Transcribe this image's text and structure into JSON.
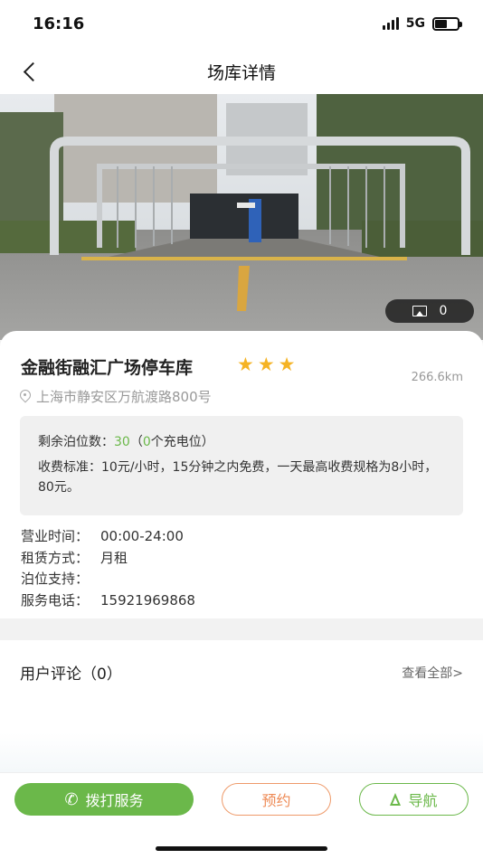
{
  "status": {
    "time": "16:16",
    "network": "5G"
  },
  "nav": {
    "title": "场库详情"
  },
  "hero": {
    "photo_count": "0"
  },
  "lot": {
    "name": "金融街融汇广场停车库",
    "stars": 3,
    "distance": "266.6km",
    "address": "上海市静安区万航渡路800号"
  },
  "spaces": {
    "remaining_label": "剩余泊位数：",
    "remaining_value": "30",
    "charging_open": "（",
    "charging_value": "0",
    "charging_suffix": "个充电位）",
    "fee_label": "收费标准：",
    "fee_text": "10元/小时，15分钟之内免费，一天最高收费规格为8小时，80元。"
  },
  "details": [
    {
      "label": "营业时间：",
      "value": "00:00-24:00"
    },
    {
      "label": "租赁方式：",
      "value": "月租"
    },
    {
      "label": "泊位支持：",
      "value": ""
    },
    {
      "label": "服务电话：",
      "value": "15921969868"
    }
  ],
  "reviews": {
    "title": "用户评论（0）",
    "view_all": "查看全部>"
  },
  "actions": {
    "call": "拨打服务",
    "reserve": "预约",
    "navigate": "导航"
  },
  "colors": {
    "accent_green": "#6bb84a",
    "accent_orange": "#ee8a55",
    "star": "#f5b324"
  }
}
